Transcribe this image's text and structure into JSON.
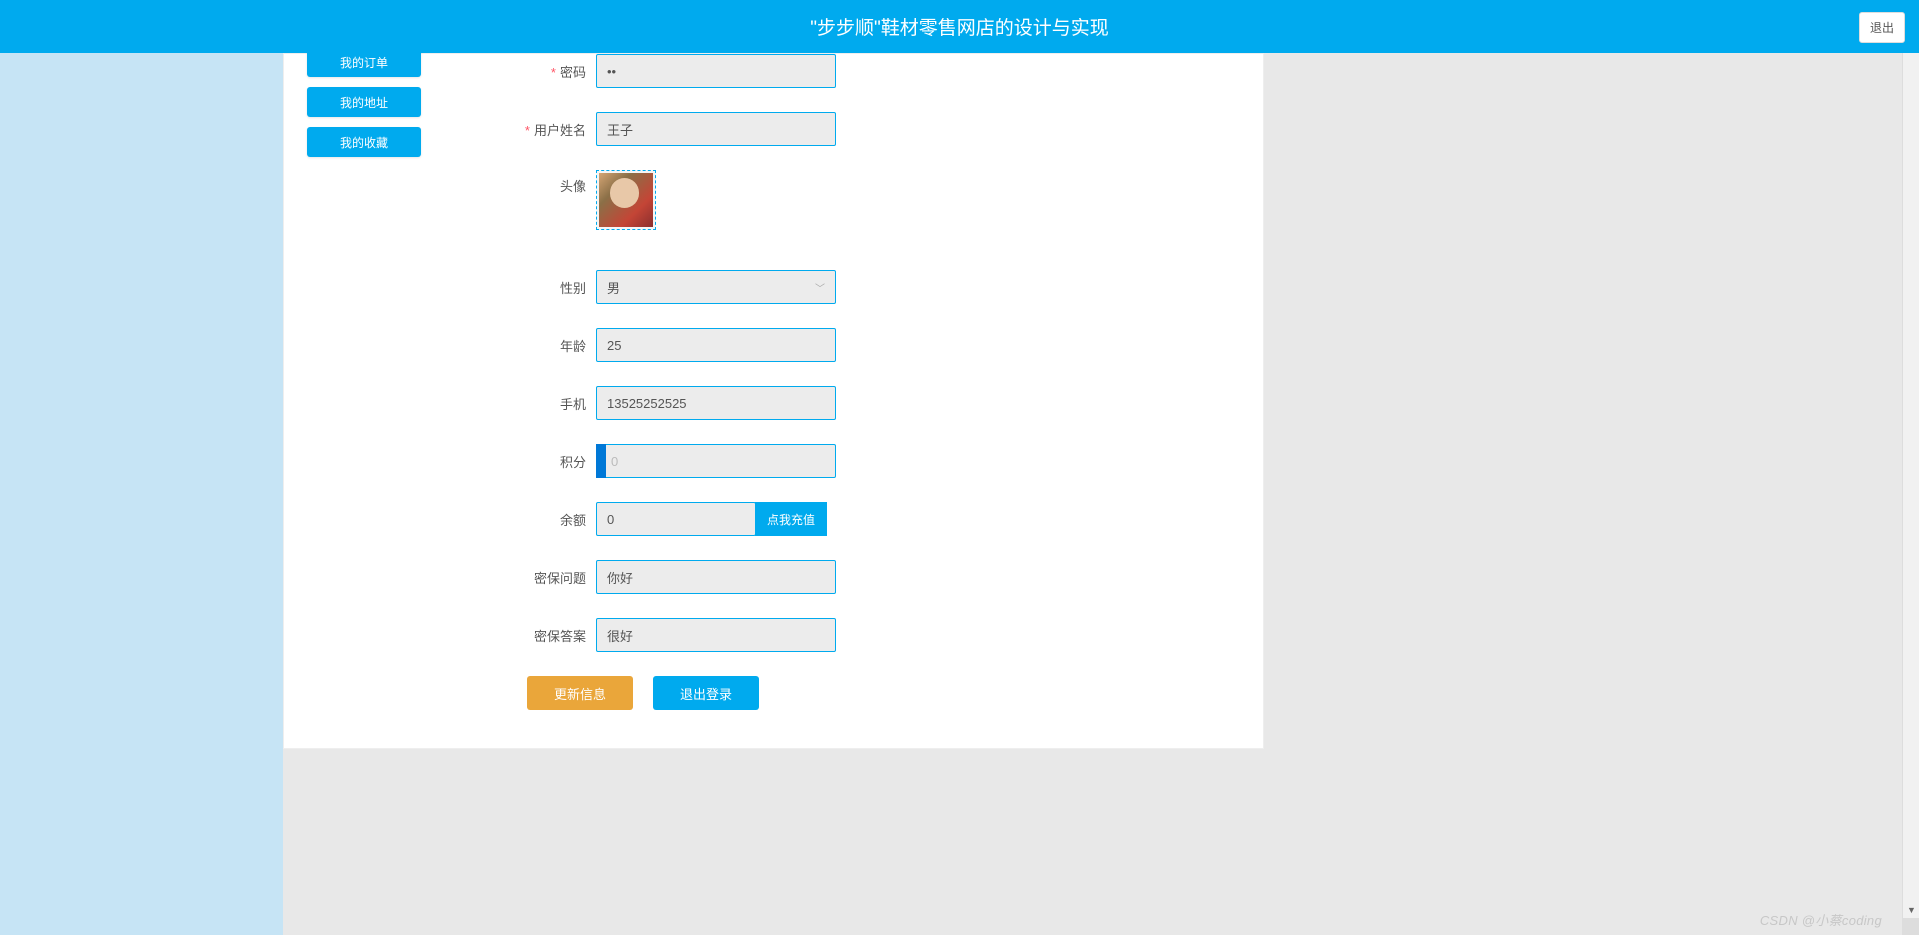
{
  "header": {
    "title": "\"步步顺\"鞋材零售网店的设计与实现",
    "logout": "退出"
  },
  "sidebar": {
    "items": [
      {
        "label": "我的订单"
      },
      {
        "label": "我的地址"
      },
      {
        "label": "我的收藏"
      }
    ]
  },
  "form": {
    "password": {
      "label": "密码",
      "value": "••"
    },
    "username": {
      "label": "用户姓名",
      "value": "王子"
    },
    "avatar": {
      "label": "头像"
    },
    "gender": {
      "label": "性别",
      "value": "男"
    },
    "age": {
      "label": "年龄",
      "value": "25"
    },
    "phone": {
      "label": "手机",
      "value": "13525252525"
    },
    "points": {
      "label": "积分",
      "value": "0"
    },
    "balance": {
      "label": "余额",
      "value": "0",
      "recharge": "点我充值"
    },
    "secQuestion": {
      "label": "密保问题",
      "value": "你好"
    },
    "secAnswer": {
      "label": "密保答案",
      "value": "很好"
    },
    "buttons": {
      "update": "更新信息",
      "logout": "退出登录"
    }
  },
  "watermark": "CSDN @小蔡coding"
}
